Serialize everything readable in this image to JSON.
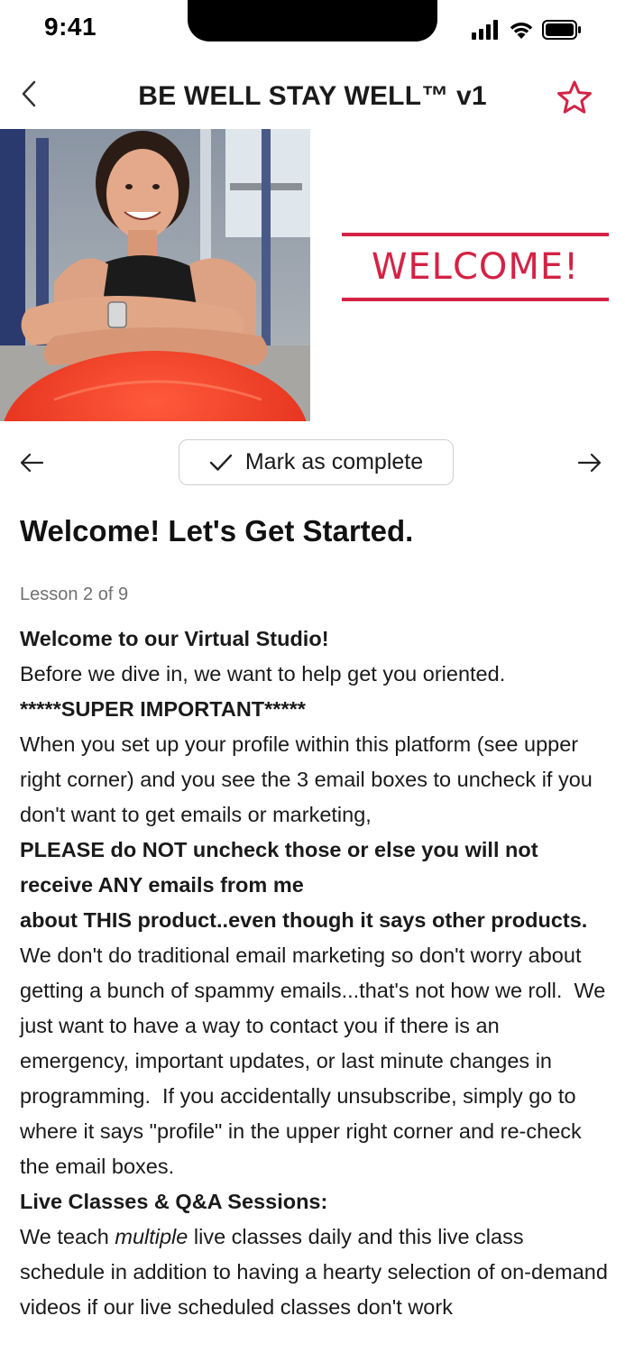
{
  "status_bar": {
    "time": "9:41"
  },
  "nav": {
    "title": "BE WELL STAY WELL™ v1",
    "back_icon": "chevron-left-icon",
    "favorite_icon": "star-outline-icon",
    "accent_color": "#d42244"
  },
  "hero": {
    "welcome_text": "WELCOME!",
    "accent_color": "#d42244"
  },
  "lesson_nav": {
    "prev_icon": "arrow-left-icon",
    "next_icon": "arrow-right-icon",
    "complete_label": "Mark as complete",
    "complete_icon": "checkmark-icon"
  },
  "lesson": {
    "title": "Welcome! Let's Get Started.",
    "count_label": "Lesson 2 of 9"
  },
  "content": {
    "heading_1": "Welcome to our Virtual Studio!",
    "para_1": "Before we dive in, we want to help get you oriented.",
    "important_label": "*****SUPER IMPORTANT*****",
    "para_2": "When you set up your profile within this platform (see upper right corner) and you see the 3 email boxes to uncheck if you don't want to get emails or marketing,",
    "bold_warning_1": "PLEASE do NOT uncheck those or else you will not receive ANY emails from me",
    "bold_warning_2": "about THIS product..even though it says other products.",
    "para_3": "  We don't do traditional email marketing so don't worry about getting a bunch of spammy emails...that's not how we roll.  We just want to have a way to contact you if there is an emergency, important updates, or last minute changes in programming.  If you accidentally unsubscribe, simply go to where it says \"profile\" in the upper right corner and re-check the email boxes.",
    "heading_2": "Live Classes & Q&A Sessions:",
    "para_4_start": "We teach ",
    "para_4_em": "multiple",
    "para_4_end": " live classes daily and this live class schedule in addition to having a hearty selection of on-demand videos if our live scheduled classes don't work"
  }
}
